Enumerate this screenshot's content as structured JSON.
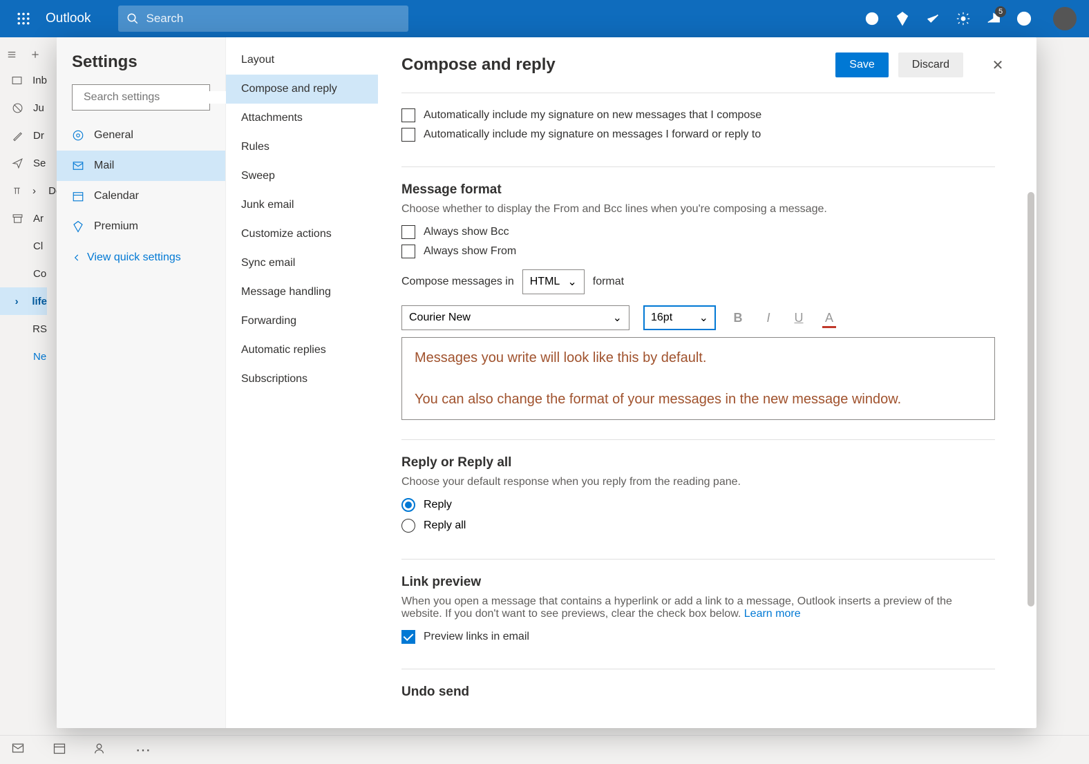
{
  "topbar": {
    "brand": "Outlook",
    "search_placeholder": "Search",
    "notif_count": "5"
  },
  "folders": [
    "Inbox",
    "Junk",
    "Drafts",
    "Sent",
    "Deleted",
    "Archive",
    "Clutter",
    "Conversation",
    "life",
    "RSS",
    "Notes"
  ],
  "folders_short": [
    "Inb",
    "Ju",
    "Dr",
    "Se",
    "De",
    "Ar",
    "Cl",
    "Co",
    "life",
    "RS",
    "Ne"
  ],
  "settings": {
    "title": "Settings",
    "search_placeholder": "Search settings",
    "categories": [
      "General",
      "Mail",
      "Calendar",
      "Premium"
    ],
    "quick_link": "View quick settings",
    "subitems": [
      "Layout",
      "Compose and reply",
      "Attachments",
      "Rules",
      "Sweep",
      "Junk email",
      "Customize actions",
      "Sync email",
      "Message handling",
      "Forwarding",
      "Automatic replies",
      "Subscriptions"
    ]
  },
  "page": {
    "title": "Compose and reply",
    "save": "Save",
    "discard": "Discard",
    "sig_new": "Automatically include my signature on new messages that I compose",
    "sig_reply": "Automatically include my signature on messages I forward or reply to",
    "msgfmt_title": "Message format",
    "msgfmt_desc": "Choose whether to display the From and Bcc lines when you're composing a message.",
    "show_bcc": "Always show Bcc",
    "show_from": "Always show From",
    "compose_pre": "Compose messages in",
    "compose_sel": "HTML",
    "compose_post": "format",
    "font_family": "Courier New",
    "font_size": "16pt",
    "preview_l1": "Messages you write will look like this by default.",
    "preview_l2": "You can also change the format of your messages in the new message window.",
    "reply_title": "Reply or Reply all",
    "reply_desc": "Choose your default response when you reply from the reading pane.",
    "reply_opt1": "Reply",
    "reply_opt2": "Reply all",
    "linkprev_title": "Link preview",
    "linkprev_desc": "When you open a message that contains a hyperlink or add a link to a message, Outlook inserts a preview of the website. If you don't want to see previews, clear the check box below. ",
    "learn_more": "Learn more",
    "linkprev_check": "Preview links in email",
    "undo_title": "Undo send"
  }
}
